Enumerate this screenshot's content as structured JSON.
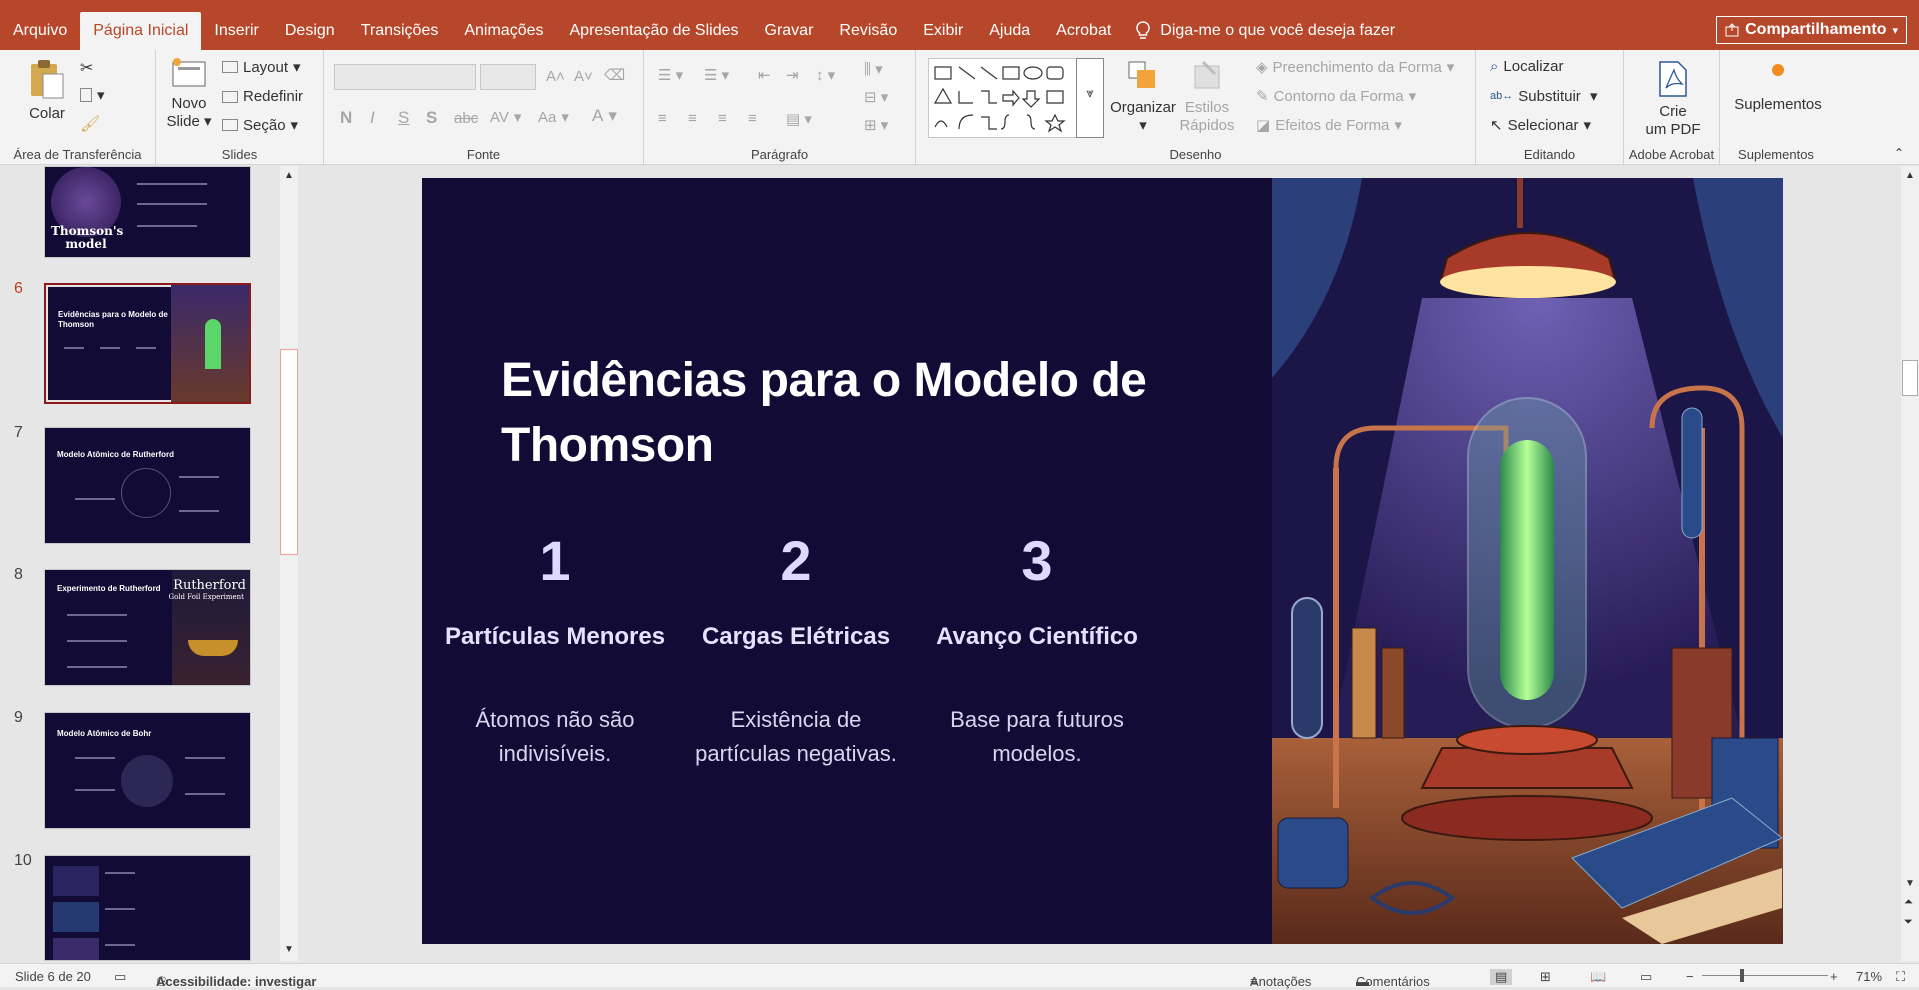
{
  "tabs": [
    {
      "label": "Arquivo",
      "active": false
    },
    {
      "label": "Página Inicial",
      "active": true
    },
    {
      "label": "Inserir",
      "active": false
    },
    {
      "label": "Design",
      "active": false
    },
    {
      "label": "Transições",
      "active": false
    },
    {
      "label": "Animações",
      "active": false
    },
    {
      "label": "Apresentação de Slides",
      "active": false
    },
    {
      "label": "Gravar",
      "active": false
    },
    {
      "label": "Revisão",
      "active": false
    },
    {
      "label": "Exibir",
      "active": false
    },
    {
      "label": "Ajuda",
      "active": false
    },
    {
      "label": "Acrobat",
      "active": false
    }
  ],
  "tell_me": "Diga-me o que você deseja fazer",
  "share": "Compartilhamento",
  "ribbon": {
    "clipboard": {
      "label": "Área de Transferência",
      "paste": "Colar"
    },
    "slides": {
      "label": "Slides",
      "new_slide_1": "Novo",
      "new_slide_2": "Slide",
      "layout": "Layout",
      "reset": "Redefinir",
      "section": "Seção"
    },
    "font": {
      "label": "Fonte",
      "bold": "N",
      "italic": "I",
      "underline": "S",
      "shadow": "S",
      "strike": "abc",
      "spacing": "AV",
      "case": "Aa",
      "color": "A"
    },
    "paragraph": {
      "label": "Parágrafo"
    },
    "drawing": {
      "label": "Desenho",
      "arrange": "Organizar",
      "quick_styles_1": "Estilos",
      "quick_styles_2": "Rápidos",
      "fill": "Preenchimento da Forma",
      "outline": "Contorno da Forma",
      "effects": "Efeitos de Forma"
    },
    "editing": {
      "label": "Editando",
      "find": "Localizar",
      "replace": "Substituir",
      "select": "Selecionar"
    },
    "acrobat": {
      "label": "Adobe Acrobat",
      "create_1": "Crie",
      "create_2": "um PDF"
    },
    "addins": {
      "label": "Suplementos",
      "button": "Suplementos"
    }
  },
  "thumbnails": [
    {
      "num": "",
      "title": "Thomson's model"
    },
    {
      "num": "6",
      "title": "Evidências para o Modelo de Thomson"
    },
    {
      "num": "7",
      "title": "Modelo Atômico de Rutherford"
    },
    {
      "num": "8",
      "title": "Experimento de Rutherford",
      "side": "Rutherford",
      "side_sub": "Gold Foil Experiment"
    },
    {
      "num": "9",
      "title": "Modelo Atômico de Bohr"
    },
    {
      "num": "10",
      "title": ""
    }
  ],
  "slide": {
    "title": "Evidências para o Modelo de Thomson",
    "columns": [
      {
        "num": "1",
        "head": "Partículas Menores",
        "body": "Átomos não são indivisíveis."
      },
      {
        "num": "2",
        "head": "Cargas Elétricas",
        "body": "Existência de partículas negativas."
      },
      {
        "num": "3",
        "head": "Avanço Científico",
        "body": "Base para futuros modelos."
      }
    ]
  },
  "status": {
    "slide_count": "Slide 6 de 20",
    "accessibility": "Acessibilidade: investigar",
    "notes": "Anotações",
    "comments": "Comentários",
    "zoom": "71%"
  },
  "colors": {
    "accent": "#b7472a",
    "slide_bg": "#110b35"
  }
}
